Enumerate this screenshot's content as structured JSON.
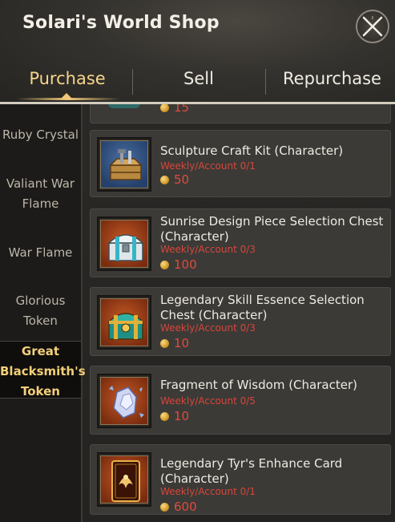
{
  "window": {
    "title": "Solari's World Shop"
  },
  "tabs": [
    {
      "label": "Purchase",
      "active": true
    },
    {
      "label": "Sell",
      "active": false
    },
    {
      "label": "Repurchase",
      "active": false
    }
  ],
  "sidebar": {
    "items": [
      {
        "label": "Ruby Crystal",
        "active": false
      },
      {
        "label": "Valiant War Flame",
        "active": false
      },
      {
        "label": "War Flame",
        "active": false
      },
      {
        "label": "Glorious Token",
        "active": false
      },
      {
        "label": "Great Blacksmith's Token",
        "active": true
      }
    ]
  },
  "items": [
    {
      "name": "",
      "limit": "",
      "price": "15",
      "icon": "unknown-item-icon"
    },
    {
      "name": "Sculpture Craft Kit (Character)",
      "limit": "Weekly/Account 0/1",
      "price": "50",
      "icon": "toolbox-icon"
    },
    {
      "name": "Sunrise Design Piece Selection Chest (Character)",
      "limit": "Weekly/Account 0/3",
      "price": "100",
      "icon": "silver-chest-icon"
    },
    {
      "name": "Legendary Skill Essence Selection Chest (Character)",
      "limit": "Weekly/Account 0/3",
      "price": "10",
      "icon": "teal-chest-icon"
    },
    {
      "name": "Fragment of Wisdom (Character)",
      "limit": "Weekly/Account 0/5",
      "price": "10",
      "icon": "crystal-fragment-icon"
    },
    {
      "name": "Legendary Tyr's Enhance Card (Character)",
      "limit": "Weekly/Account 0/1",
      "price": "600",
      "icon": "enhance-card-icon"
    }
  ],
  "colors": {
    "accent_gold": "#f0c878",
    "price_red": "#e14b3d",
    "limit_red": "#d7463a",
    "card_bg": "#3b3a37"
  }
}
